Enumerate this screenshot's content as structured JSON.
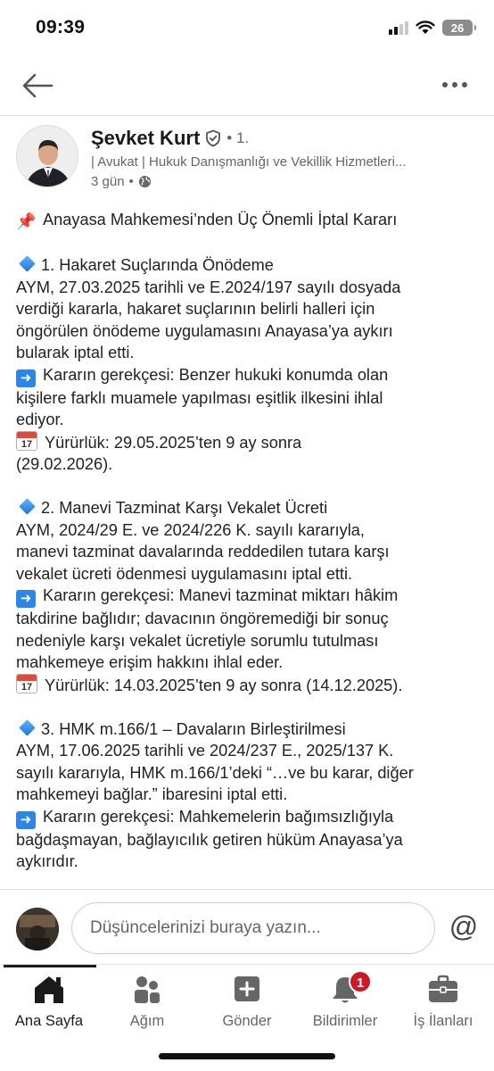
{
  "status_bar": {
    "time": "09:39",
    "battery": "26"
  },
  "top_nav": {
    "back_icon": "arrow-left-icon",
    "more_icon": "more-horizontal-icon"
  },
  "author": {
    "name": "Şevket Kurt",
    "degree": "• 1.",
    "headline": "| Avukat | Hukuk Danışmanlığı ve Vekillik Hizmetleri...",
    "time": "3 gün",
    "visibility_icon": "globe-icon"
  },
  "post": {
    "title": "Anayasa Mahkemesi’nden Üç Önemli İptal Kararı",
    "section1": {
      "heading": "1. Hakaret Suçlarında Önödeme",
      "body_lines": [
        " AYM, 27.03.2025 tarihli ve E.2024/197 sayılı dosyada",
        "verdiği kararla, hakaret suçlarının belirli halleri için",
        "öngörülen önödeme uygulamasını Anayasa’ya aykırı",
        "bularak iptal etti."
      ],
      "reason_lines": [
        "Kararın gerekçesi: Benzer hukuki konumda olan",
        "kişilere farklı muamele yapılması eşitlik ilkesini ihlal",
        "ediyor."
      ],
      "effective_lines": [
        "Yürürlük: 29.05.2025’ten 9 ay sonra",
        "(29.02.2026)."
      ]
    },
    "section2": {
      "heading": "2. Manevi Tazminat Karşı Vekalet Ücreti",
      "body_lines": [
        " AYM, 2024/29 E. ve 2024/226 K. sayılı kararıyla,",
        "manevi tazminat davalarında reddedilen tutara karşı",
        "vekalet ücreti ödenmesi uygulamasını iptal etti."
      ],
      "reason_lines": [
        "Kararın gerekçesi: Manevi tazminat miktarı hâkim",
        "takdirine bağlıdır; davacının öngöremediği bir sonuç",
        "nedeniyle karşı vekalet ücretiyle sorumlu tutulması",
        "mahkemeye erişim hakkını ihlal eder."
      ],
      "effective_lines": [
        "Yürürlük: 14.03.2025’ten 9 ay sonra (14.12.2025)."
      ]
    },
    "section3": {
      "heading": "3. HMK m.166/1 – Davaların Birleştirilmesi",
      "body_lines": [
        " AYM, 17.06.2025 tarihli ve 2024/237 E., 2025/137 K.",
        "sayılı kararıyla, HMK m.166/1’deki “…ve bu karar, diğer",
        "mahkemeyi bağlar.” ibaresini iptal etti."
      ],
      "reason_lines": [
        "Kararın gerekçesi: Mahkemelerin bağımsızlığıyla",
        "bağdaşmayan, bağlayıcılık getiren hüküm Anayasa’ya",
        "aykırıdır."
      ]
    },
    "calendar_day": "17"
  },
  "comment": {
    "placeholder": "Düşüncelerinizi buraya yazın...",
    "mention_symbol": "@"
  },
  "bottom_nav": {
    "items": [
      {
        "label": "Ana Sayfa",
        "icon": "home-icon",
        "active": true
      },
      {
        "label": "Ağım",
        "icon": "network-icon",
        "active": false
      },
      {
        "label": "Gönder",
        "icon": "post-plus-icon",
        "active": false
      },
      {
        "label": "Bildirimler",
        "icon": "bell-icon",
        "active": false,
        "badge": "1"
      },
      {
        "label": "İş İlanları",
        "icon": "briefcase-icon",
        "active": false
      }
    ]
  },
  "colors": {
    "badge": "#cb1a24",
    "accent_blue": "#2c86e8",
    "text_secondary": "#666666"
  }
}
